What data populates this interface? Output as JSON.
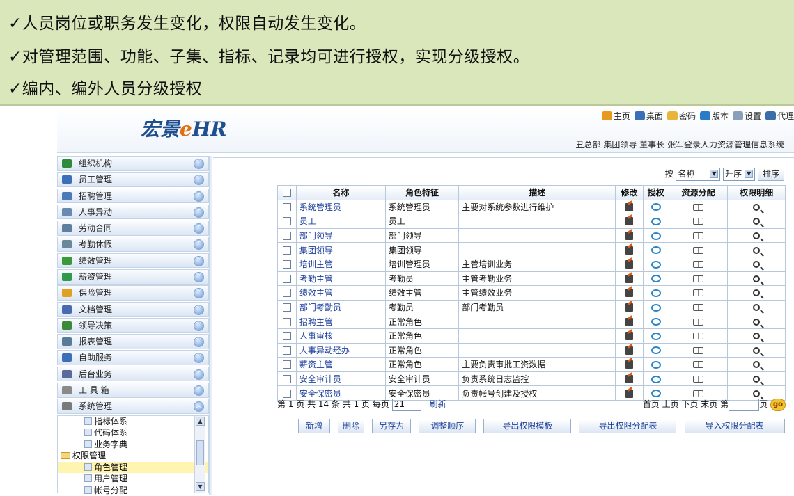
{
  "banner": {
    "lines": [
      "✓人员岗位或职务发生变化，权限自动发生变化。",
      "✓对管理范围、功能、子集、指标、记录均可进行授权，实现分级授权。",
      "✓编内、编外人员分级授权"
    ]
  },
  "header": {
    "logo_main": "宏景",
    "logo_e": "e",
    "logo_hr": "HR",
    "top_links": [
      {
        "label": "主页",
        "icon": "house-icon",
        "color": "#e69a1f"
      },
      {
        "label": "桌面",
        "icon": "desktop-icon",
        "color": "#3b6fb8"
      },
      {
        "label": "密码",
        "icon": "lock-icon",
        "color": "#e8b53a"
      },
      {
        "label": "版本",
        "icon": "info-icon",
        "color": "#2a7cc8"
      },
      {
        "label": "设置",
        "icon": "tools-icon",
        "color": "#8aa0b8"
      },
      {
        "label": "代理",
        "icon": "proxy-icon",
        "color": "#3a6ea8"
      }
    ],
    "user_line": "丑总部 集团领导 董事长 张军登录人力资源管理信息系统"
  },
  "sidebar": {
    "items": [
      {
        "label": "组织机构",
        "icon": "org-icon",
        "color": "#2f8a3a"
      },
      {
        "label": "员工管理",
        "icon": "staff-icon",
        "color": "#3b6fb8"
      },
      {
        "label": "招聘管理",
        "icon": "recruit-icon",
        "color": "#4a7ab8"
      },
      {
        "label": "人事异动",
        "icon": "transfer-icon",
        "color": "#6a8ab0"
      },
      {
        "label": "劳动合同",
        "icon": "contract-icon",
        "color": "#5f7fa0"
      },
      {
        "label": "考勤休假",
        "icon": "attendance-icon",
        "color": "#6a8a9a"
      },
      {
        "label": "绩效管理",
        "icon": "performance-icon",
        "color": "#3a9a3a"
      },
      {
        "label": "薪资管理",
        "icon": "salary-icon",
        "color": "#2f9a4a"
      },
      {
        "label": "保险管理",
        "icon": "insurance-icon",
        "color": "#e0a020"
      },
      {
        "label": "文档管理",
        "icon": "document-icon",
        "color": "#4a6ab0"
      },
      {
        "label": "领导决策",
        "icon": "decision-icon",
        "color": "#3a8a3a"
      },
      {
        "label": "报表管理",
        "icon": "report-icon",
        "color": "#5a7a9a"
      },
      {
        "label": "自助服务",
        "icon": "self-service-icon",
        "color": "#3b6fb8"
      },
      {
        "label": "后台业务",
        "icon": "backend-icon",
        "color": "#5a6a9a"
      },
      {
        "label": "工 具 箱",
        "icon": "toolbox-icon",
        "color": "#8a8a8a"
      },
      {
        "label": "系统管理",
        "icon": "system-icon",
        "color": "#7a7a7a"
      }
    ],
    "tree": [
      {
        "label": "指标体系",
        "kind": "doc",
        "indent": 1
      },
      {
        "label": "代码体系",
        "kind": "doc",
        "indent": 1
      },
      {
        "label": "业务字典",
        "kind": "doc",
        "indent": 1
      },
      {
        "label": "权限管理",
        "kind": "folder",
        "indent": 0
      },
      {
        "label": "角色管理",
        "kind": "doc",
        "indent": 1,
        "selected": true
      },
      {
        "label": "用户管理",
        "kind": "doc",
        "indent": 1
      },
      {
        "label": "帐号分配",
        "kind": "doc",
        "indent": 1
      }
    ]
  },
  "sortbar": {
    "prefix": "按",
    "field": "名称",
    "order": "升序",
    "button": "排序"
  },
  "table": {
    "columns": [
      "名称",
      "角色特征",
      "描述",
      "修改",
      "授权",
      "资源分配",
      "权限明细"
    ],
    "rows": [
      {
        "name": "系统管理员",
        "trait": "系统管理员",
        "desc": "主要对系统参数进行维护"
      },
      {
        "name": "员工",
        "trait": "员工",
        "desc": ""
      },
      {
        "name": "部门领导",
        "trait": "部门领导",
        "desc": ""
      },
      {
        "name": "集团领导",
        "trait": "集团领导",
        "desc": ""
      },
      {
        "name": "培训主管",
        "trait": "培训管理员",
        "desc": "主管培训业务"
      },
      {
        "name": "考勤主管",
        "trait": "考勤员",
        "desc": "主管考勤业务"
      },
      {
        "name": "绩效主管",
        "trait": "绩效主管",
        "desc": "主管绩效业务"
      },
      {
        "name": "部门考勤员",
        "trait": "考勤员",
        "desc": "部门考勤员"
      },
      {
        "name": "招聘主管",
        "trait": "正常角色",
        "desc": ""
      },
      {
        "name": "人事审核",
        "trait": "正常角色",
        "desc": ""
      },
      {
        "name": "人事异动经办",
        "trait": "正常角色",
        "desc": ""
      },
      {
        "name": "薪资主管",
        "trait": "正常角色",
        "desc": "主要负责审批工资数据"
      },
      {
        "name": "安全审计员",
        "trait": "安全审计员",
        "desc": "负责系统日志监控"
      },
      {
        "name": "安全保密员",
        "trait": "安全保密员",
        "desc": "负责帐号创建及授权"
      }
    ]
  },
  "pager": {
    "summary": "第 1 页 共 14 条 共 1 页 每页",
    "per_page": "21",
    "refresh": "刷新",
    "first": "首页",
    "prev": "上页",
    "next": "下页",
    "last": "末页",
    "goto_prefix": "第",
    "goto_suffix": "页",
    "go": "go"
  },
  "actions": [
    "新增",
    "删除",
    "另存为",
    "调整顺序",
    "导出权限模板",
    "导出权限分配表",
    "导入权限分配表"
  ]
}
